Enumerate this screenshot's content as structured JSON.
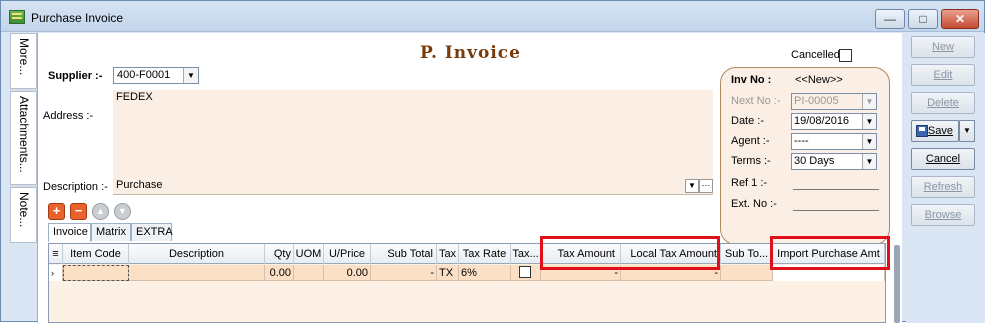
{
  "window": {
    "title": "Purchase Invoice",
    "min": "—",
    "max": "□",
    "close": "✕"
  },
  "side_tabs": [
    "More...",
    "Attachments...",
    "Note..."
  ],
  "form": {
    "page_title": "P.  Invoice",
    "supplier_label": "Supplier :-",
    "supplier_value": "400-F0001",
    "supplier_name": "FEDEX",
    "address_label": "Address :-",
    "description_label": "Description :-",
    "description_value": "Purchase",
    "cancelled_label": "Cancelled"
  },
  "inv_panel": {
    "inv_no_label": "Inv No :",
    "inv_no_value": "<<New>>",
    "next_no_label": "Next No :-",
    "next_no_value": "PI-00005",
    "date_label": "Date :-",
    "date_value": "19/08/2016",
    "agent_label": "Agent :-",
    "agent_value": "----",
    "terms_label": "Terms :-",
    "terms_value": "30 Days",
    "ref1_label": "Ref 1 :-",
    "ext_no_label": "Ext. No :-"
  },
  "toolbar_icons": [
    "plus-icon",
    "minus-icon",
    "arrow-up-icon",
    "arrow-down-icon"
  ],
  "tabs": [
    "Invoice",
    "Matrix",
    "EXTRA"
  ],
  "grid": {
    "headers": [
      "≡",
      "Item Code",
      "Description",
      "Qty",
      "UOM",
      "U/Price",
      "Sub Total",
      "Tax",
      "Tax Rate",
      "Tax...",
      "Tax Amount",
      "Local Tax Amount",
      "Sub To...",
      "Import Purchase Amt"
    ],
    "row": {
      "marker": "›",
      "item_code": "",
      "description": "",
      "qty": "0.00",
      "uom": "",
      "uprice": "0.00",
      "sub_total": "-",
      "tax": "TX",
      "tax_rate": "6%",
      "tax_amount": "-",
      "local_tax_amount": "-",
      "sub_total2": "",
      "import_purchase_amt": ""
    }
  },
  "right_buttons": {
    "new": "New",
    "edit": "Edit",
    "delete": "Delete",
    "save": "Save",
    "cancel": "Cancel",
    "refresh": "Refresh",
    "browse": "Browse"
  },
  "highlight_color": "#e0101a"
}
